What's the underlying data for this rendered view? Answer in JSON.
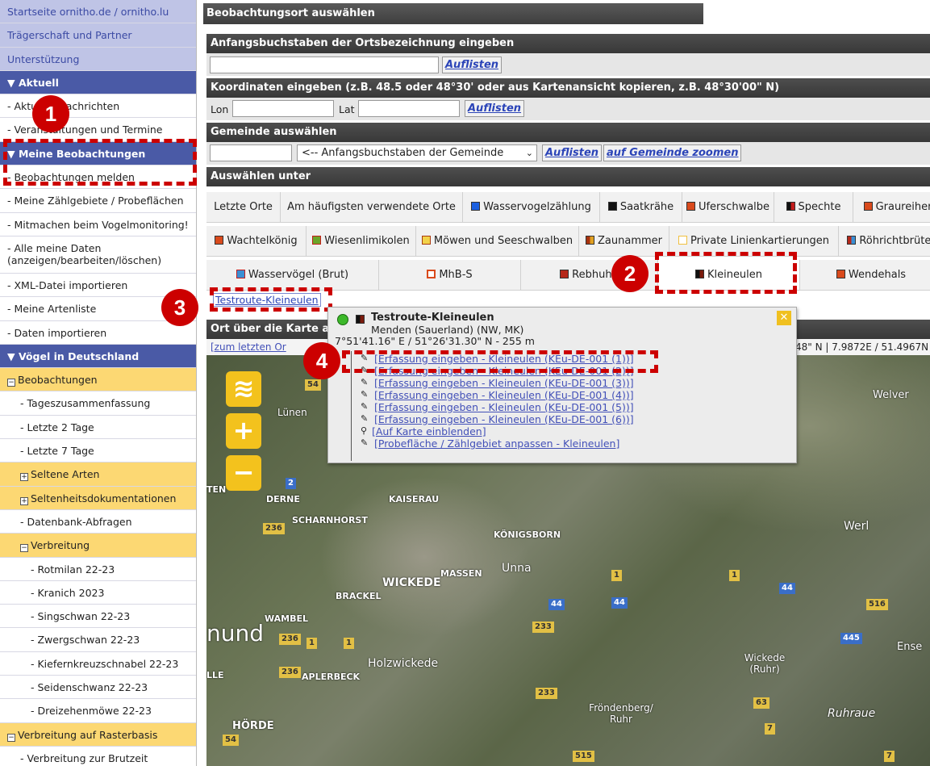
{
  "sidebar": {
    "top_links": [
      "Startseite ornitho.de / ornitho.lu",
      "Trägerschaft und Partner",
      "Unterstützung"
    ],
    "aktuell": {
      "title": "Aktuell",
      "items": [
        "Aktuelle Nachrichten",
        "Veranstaltungen und Termine"
      ]
    },
    "beob": {
      "title": "Meine Beobachtungen",
      "items": [
        "Beobachtungen melden",
        "Meine Zählgebiete / Probeflächen",
        "Mitmachen beim Vogelmonitoring!",
        "Alle meine Daten (anzeigen/bearbeiten/löschen)",
        "XML-Datei importieren",
        "Meine Artenliste",
        "Daten importieren"
      ]
    },
    "voegel": {
      "title": "Vögel in Deutschland"
    },
    "beobachtungen": "Beobachtungen",
    "beob_sub": [
      "Tageszusammenfassung",
      "Letzte 2 Tage",
      "Letzte 7 Tage"
    ],
    "seltene": "Seltene Arten",
    "seltenheit": "Seltenheitsdokumentationen",
    "datenbank": "Datenbank-Abfragen",
    "verbreitung": "Verbreitung",
    "verbreitung_items": [
      "Rotmilan 22-23",
      "Kranich 2023",
      "Singschwan 22-23",
      "Zwergschwan 22-23",
      "Kiefernkreuzschnabel 22-23",
      "Seidenschwanz 22-23",
      "Dreizehenmöwe 22-23"
    ],
    "raster": "Verbreitung auf Rasterbasis",
    "raster_items": [
      "Verbreitung zur Brutzeit"
    ]
  },
  "main": {
    "title": "Beobachtungsort auswählen",
    "sec1": "Anfangsbuchstaben der Ortsbezeichnung eingeben",
    "auflisten": "Auflisten",
    "sec2": "Koordinaten eingeben (z.B. 48.5 oder 48°30' oder aus Kartenansicht kopieren, z.B. 48°30'00\" N)",
    "lon": "Lon",
    "lat": "Lat",
    "sec3": "Gemeinde auswählen",
    "gemeinde_select": "<-- Anfangsbuchstaben der Gemeinde",
    "zoom": "auf Gemeinde zoomen",
    "sec4": "Auswählen unter",
    "tabs1": [
      {
        "label": "Letzte Orte",
        "color": ""
      },
      {
        "label": "Am häufigsten verwendete Orte",
        "color": ""
      },
      {
        "label": "Wasservogelzählung",
        "color": "#1a5fe0"
      },
      {
        "label": "Saatkrähe",
        "color": "#111111"
      },
      {
        "label": "Uferschwalbe",
        "color": "#d94a1c"
      },
      {
        "label": "Spechte",
        "color": "#c41c1c"
      },
      {
        "label": "Graureiher",
        "color": "#d94a1c"
      }
    ],
    "tabs2": [
      {
        "label": "Wachtelkönig",
        "color": "#d94a1c"
      },
      {
        "label": "Wiesenlimikolen",
        "color": "#6ba52a"
      },
      {
        "label": "Möwen und Seeschwalben",
        "color": "#d9b21c"
      },
      {
        "label": "Zaunammer",
        "color": "#a8320f"
      },
      {
        "label": "Private Linienkartierungen",
        "color": "#f0c040"
      },
      {
        "label": "Röhrichtbrüter",
        "color": "#b5281a"
      }
    ],
    "tabs3": [
      {
        "label": "Wasservögel (Brut)",
        "color": "#3a8fd4"
      },
      {
        "label": "MhB-S",
        "color": "#d94a1c"
      },
      {
        "label": "Rebhuhn",
        "color": "#b5281a"
      },
      {
        "label": "Kleineulen",
        "color": "#7a1a0c"
      },
      {
        "label": "Wendehals",
        "color": "#d94a1c"
      }
    ],
    "route_link": "Testroute-Kleineulen",
    "map_header": "Ort über die Karte a",
    "map_link": "[zum letzten Or",
    "coord_readout": "48\" N | 7.9872E / 51.4967N"
  },
  "popup": {
    "title": "Testroute-Kleineulen",
    "place": "Menden (Sauerland) (NW, MK)",
    "coords": "7°51'41.16\" E / 51°26'31.30\" N - 255 m",
    "links": [
      "[Erfassung eingeben - Kleineulen (KEu-DE-001 (1))]",
      "[Erfassung eingeben - Kleineulen (KEu-DE-001 (2))]",
      "[Erfassung eingeben - Kleineulen (KEu-DE-001 (3))]",
      "[Erfassung eingeben - Kleineulen (KEu-DE-001 (4))]",
      "[Erfassung eingeben - Kleineulen (KEu-DE-001 (5))]",
      "[Erfassung eingeben - Kleineulen (KEu-DE-001 (6))]",
      "[Auf Karte einblenden]",
      "[Probefläche / Zählgebiet anpassen - Kleineulen]"
    ]
  },
  "map": {
    "places": [
      "Lünen",
      "Welver",
      "DERNE",
      "KAISERAU",
      "SCHARNHORST",
      "KÖNIGSBORN",
      "Werl",
      "WICKEDE",
      "MASSEN",
      "Unna",
      "BRACKEL",
      "WAMBEL",
      "nund",
      "Holzwickede",
      "APLERBECK",
      "Wickede (Ruhr)",
      "Fröndenberg/ Ruhr",
      "Ruhraue",
      "HÖRDE",
      "Ense",
      "LLE",
      "TEN"
    ],
    "roads": [
      "54",
      "2",
      "236",
      "1",
      "44",
      "233",
      "516",
      "445",
      "63",
      "7",
      "515"
    ]
  },
  "annotations": [
    "1",
    "2",
    "3",
    "4"
  ]
}
